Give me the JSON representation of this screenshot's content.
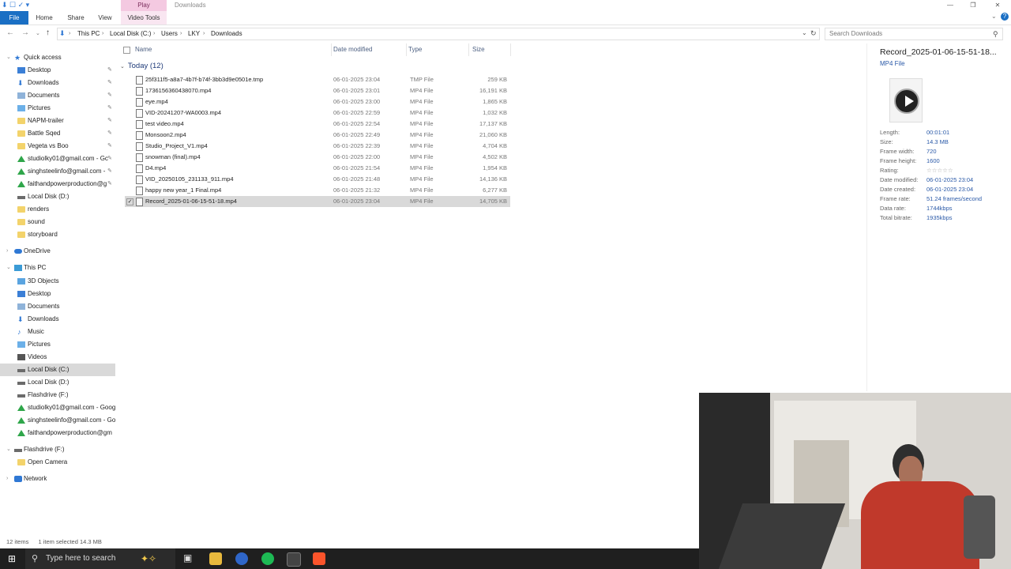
{
  "window": {
    "title": "Downloads",
    "context_group": "Play",
    "tabs": [
      "File",
      "Home",
      "Share",
      "View",
      "Video Tools"
    ]
  },
  "address": {
    "crumbs": [
      "This PC",
      "Local Disk (C:)",
      "Users",
      "LKY",
      "Downloads"
    ],
    "search_placeholder": "Search Downloads"
  },
  "nav": {
    "quick_access": "Quick access",
    "quick_items": [
      "Desktop",
      "Downloads",
      "Documents",
      "Pictures",
      "NAPM-trailer",
      "Battle Sqed",
      "Vegeta vs Boo",
      "studiolky01@gmail.com - Gc",
      "singhsteelinfo@gmail.com -",
      "faithandpowerproduction@g",
      "Local Disk (D:)",
      "renders",
      "sound",
      "storyboard"
    ],
    "onedrive": "OneDrive",
    "this_pc": "This PC",
    "pc_items": [
      "3D Objects",
      "Desktop",
      "Documents",
      "Downloads",
      "Music",
      "Pictures",
      "Videos",
      "Local Disk (C:)",
      "Local Disk (D:)",
      "Flashdrive (F:)",
      "studiolky01@gmail.com - Goog",
      "singhsteelinfo@gmail.com - Go",
      "faithandpowerproduction@gm"
    ],
    "flashdrive": "Flashdrive (F:)",
    "flash_items": [
      "Open Camera"
    ],
    "network": "Network"
  },
  "list": {
    "columns": [
      "Name",
      "Date modified",
      "Type",
      "Size"
    ],
    "group": "Today (12)",
    "files": [
      {
        "name": "25f311f5-a8a7-4b7f-b74f-3bb3d9e0501e.tmp",
        "date": "06-01-2025 23:04",
        "type": "TMP File",
        "size": "259 KB"
      },
      {
        "name": "1736156360438070.mp4",
        "date": "06-01-2025 23:01",
        "type": "MP4 File",
        "size": "16,191 KB"
      },
      {
        "name": "eye.mp4",
        "date": "06-01-2025 23:00",
        "type": "MP4 File",
        "size": "1,865 KB"
      },
      {
        "name": "VID-20241207-WA0003.mp4",
        "date": "06-01-2025 22:59",
        "type": "MP4 File",
        "size": "1,032 KB"
      },
      {
        "name": "test video.mp4",
        "date": "06-01-2025 22:54",
        "type": "MP4 File",
        "size": "17,137 KB"
      },
      {
        "name": "Monsoon2.mp4",
        "date": "06-01-2025 22:49",
        "type": "MP4 File",
        "size": "21,060 KB"
      },
      {
        "name": "Studio_Project_V1.mp4",
        "date": "06-01-2025 22:39",
        "type": "MP4 File",
        "size": "4,704 KB"
      },
      {
        "name": "snowman (final).mp4",
        "date": "06-01-2025 22:00",
        "type": "MP4 File",
        "size": "4,502 KB"
      },
      {
        "name": "D4.mp4",
        "date": "06-01-2025 21:54",
        "type": "MP4 File",
        "size": "1,954 KB"
      },
      {
        "name": "VID_20250105_231133_911.mp4",
        "date": "06-01-2025 21:48",
        "type": "MP4 File",
        "size": "14,136 KB"
      },
      {
        "name": "happy new year_1 Final.mp4",
        "date": "06-01-2025 21:32",
        "type": "MP4 File",
        "size": "6,277 KB"
      },
      {
        "name": "Record_2025-01-06-15-51-18.mp4",
        "date": "06-01-2025 23:04",
        "type": "MP4 File",
        "size": "14,705 KB",
        "selected": true
      }
    ]
  },
  "details": {
    "title": "Record_2025-01-06-15-51-18...",
    "type": "MP4 File",
    "props": [
      {
        "k": "Length:",
        "v": "00:01:01"
      },
      {
        "k": "Size:",
        "v": "14.3 MB"
      },
      {
        "k": "Frame width:",
        "v": "720"
      },
      {
        "k": "Frame height:",
        "v": "1600"
      },
      {
        "k": "Rating:",
        "v": "☆☆☆☆☆"
      },
      {
        "k": "Date modified:",
        "v": "06-01-2025 23:04"
      },
      {
        "k": "Date created:",
        "v": "06-01-2025 23:04"
      },
      {
        "k": "Frame rate:",
        "v": "51.24 frames/second"
      },
      {
        "k": "Data rate:",
        "v": "1744kbps"
      },
      {
        "k": "Total bitrate:",
        "v": "1935kbps"
      }
    ]
  },
  "status": {
    "items": "12 items",
    "selected": "1 item selected  14.3 MB"
  },
  "taskbar": {
    "search_placeholder": "Type here to search"
  }
}
